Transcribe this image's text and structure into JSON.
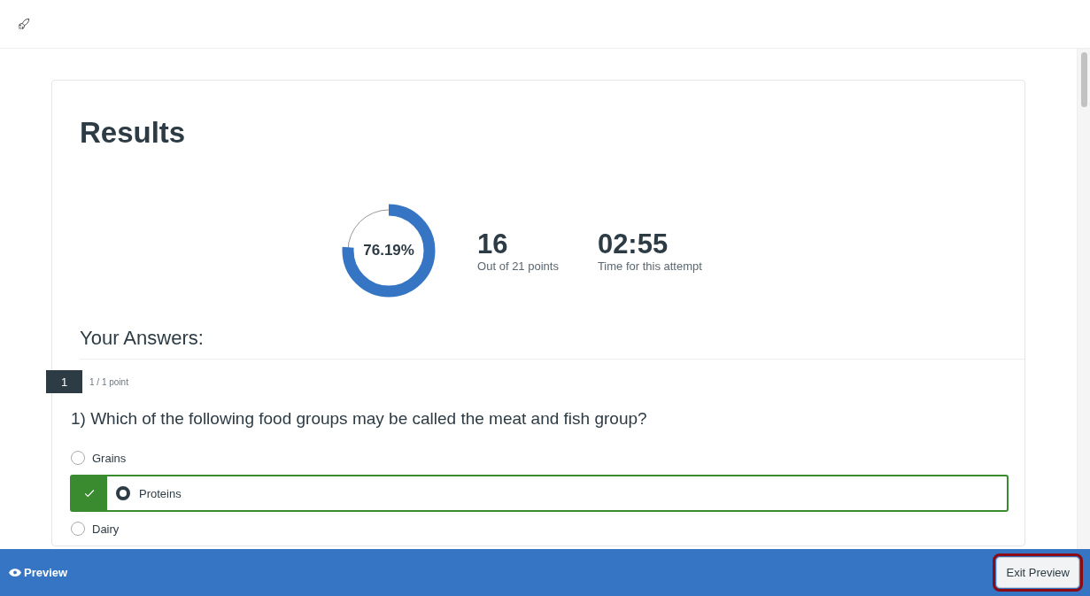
{
  "results": {
    "title": "Results",
    "score": {
      "percent": "76.19%",
      "level": 0.7619
    },
    "stats": [
      {
        "value": "16",
        "label": "Out of 21 points"
      },
      {
        "value": "02:55",
        "label": "Time for this attempt"
      }
    ]
  },
  "answers": {
    "title": "Your Answers:",
    "questions": [
      {
        "number": "1",
        "points": "1 / 1 point",
        "text": "1) Which of the following food groups may be called the meat and fish group?",
        "choices": [
          {
            "label": "Grains",
            "selected": false,
            "correct": false
          },
          {
            "label": "Proteins",
            "selected": true,
            "correct": true
          },
          {
            "label": "Dairy",
            "selected": false,
            "correct": false
          }
        ]
      }
    ]
  },
  "footer": {
    "label": "Preview",
    "button": "Exit Preview"
  }
}
